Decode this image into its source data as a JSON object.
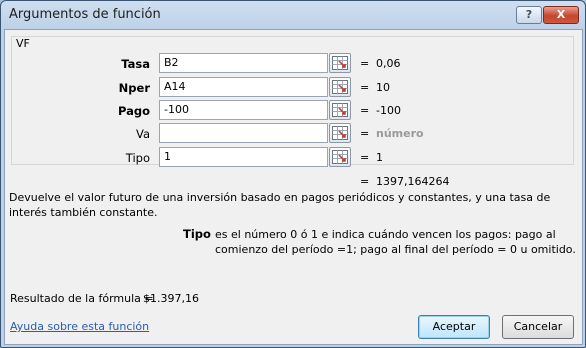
{
  "window": {
    "title": "Argumentos de función",
    "help_glyph": "?",
    "close_glyph": "X"
  },
  "function_name": "VF",
  "arguments": [
    {
      "label": "Tasa",
      "value": "B2",
      "result": "0,06",
      "bold": true,
      "placeholder": false
    },
    {
      "label": "Nper",
      "value": "A14",
      "result": "10",
      "bold": true,
      "placeholder": false
    },
    {
      "label": "Pago",
      "value": "-100",
      "result": "-100",
      "bold": true,
      "placeholder": false
    },
    {
      "label": "Va",
      "value": "",
      "result": "número",
      "bold": false,
      "placeholder": true
    },
    {
      "label": "Tipo",
      "value": "1",
      "result": "1",
      "bold": false,
      "placeholder": false
    }
  ],
  "equals_sign": "=",
  "function_result": "1397,164264",
  "description": "Devuelve el valor futuro de una inversión basado en pagos periódicos y constantes, y una tasa de interés también constante.",
  "arg_help": {
    "name": "Tipo",
    "text": "es el número 0 ó 1 e indica cuándo vencen los pagos: pago al comienzo del período =1; pago al final del período = 0 u omitido."
  },
  "formula_result": {
    "label": "Resultado de la fórmula =",
    "value": "$1.397,16"
  },
  "help_link": "Ayuda sobre esta función",
  "buttons": {
    "accept": "Aceptar",
    "cancel": "Cancelar"
  }
}
